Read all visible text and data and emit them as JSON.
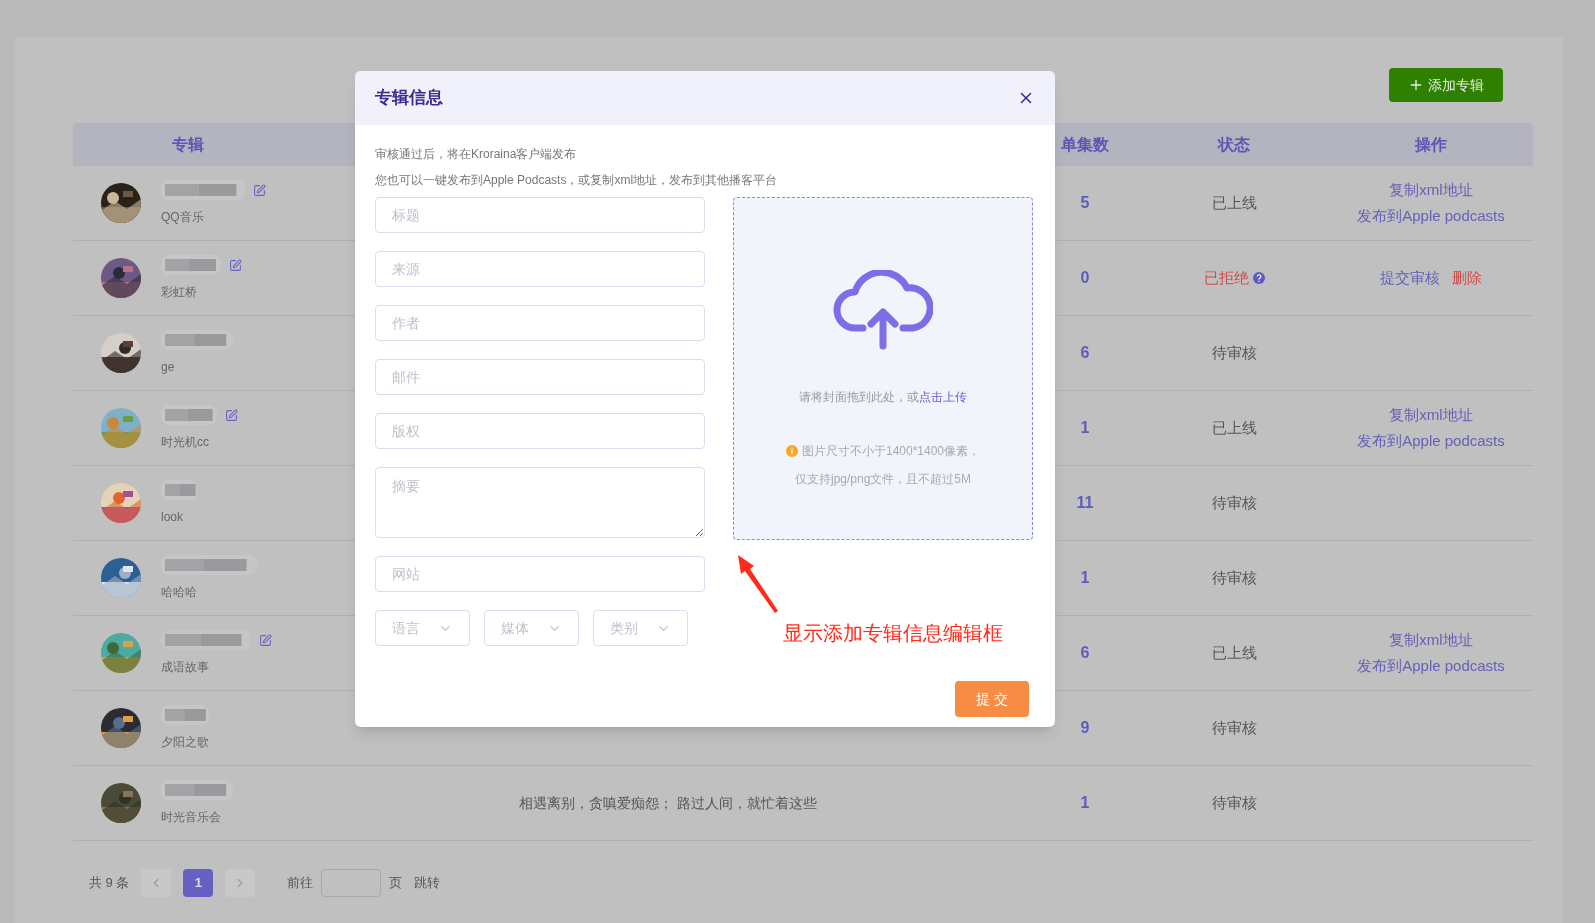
{
  "add_button": "添加专辑",
  "columns": {
    "album": "专辑",
    "episodes": "单集数",
    "status": "状态",
    "actions": "操作"
  },
  "rows": [
    {
      "source": "QQ音乐",
      "editable": true,
      "episodes": "5",
      "status": {
        "label": "已上线",
        "kind": "online"
      },
      "actions": [
        {
          "label": "复制xml地址",
          "kind": "link"
        },
        {
          "label": "发布到Apple podcasts",
          "kind": "link"
        }
      ]
    },
    {
      "source": "彩虹桥",
      "editable": true,
      "episodes": "0",
      "status": {
        "label": "已拒绝",
        "kind": "rejected"
      },
      "actions": [
        {
          "label": "提交审核",
          "kind": "link"
        },
        {
          "label": "删除",
          "kind": "danger"
        }
      ]
    },
    {
      "source": "ge",
      "editable": false,
      "episodes": "6",
      "status": {
        "label": "待审核",
        "kind": "pending"
      },
      "actions": []
    },
    {
      "source": "时光机cc",
      "editable": true,
      "episodes": "1",
      "status": {
        "label": "已上线",
        "kind": "online"
      },
      "actions": [
        {
          "label": "复制xml地址",
          "kind": "link"
        },
        {
          "label": "发布到Apple podcasts",
          "kind": "link"
        }
      ]
    },
    {
      "source": "look",
      "editable": false,
      "episodes": "11",
      "status": {
        "label": "待审核",
        "kind": "pending"
      },
      "actions": []
    },
    {
      "source": "哈哈哈",
      "editable": false,
      "episodes": "1",
      "status": {
        "label": "待审核",
        "kind": "pending"
      },
      "actions": []
    },
    {
      "source": "成语故事",
      "editable": true,
      "episodes": "6",
      "status": {
        "label": "已上线",
        "kind": "online"
      },
      "actions": [
        {
          "label": "复制xml地址",
          "kind": "link"
        },
        {
          "label": "发布到Apple podcasts",
          "kind": "link"
        }
      ]
    },
    {
      "source": "夕阳之歌",
      "editable": false,
      "episodes": "9",
      "status": {
        "label": "待审核",
        "kind": "pending"
      },
      "actions": []
    },
    {
      "source": "时光音乐会",
      "editable": false,
      "description": "相遇离别，贪嗔爱痴怨； 路过人间，就忙着这些",
      "episodes": "1",
      "status": {
        "label": "待审核",
        "kind": "pending"
      },
      "actions": []
    }
  ],
  "pagination": {
    "total": "共 9 条",
    "pages": [
      {
        "label": "1",
        "selected": true
      }
    ],
    "goto": "前往",
    "unit": "页",
    "jump": "跳转"
  },
  "dialog": {
    "title": "专辑信息",
    "notes": [
      "审核通过后，将在Kroraina客户端发布",
      "您也可以一键发布到Apple Podcasts，或复制xml地址，发布到其他播客平台"
    ],
    "fields": [
      {
        "placeholder": "标题",
        "kind": "input"
      },
      {
        "placeholder": "来源",
        "kind": "input"
      },
      {
        "placeholder": "作者",
        "kind": "input"
      },
      {
        "placeholder": "邮件",
        "kind": "input"
      },
      {
        "placeholder": "版权",
        "kind": "input"
      },
      {
        "placeholder": "摘要",
        "kind": "textarea"
      },
      {
        "placeholder": "网站",
        "kind": "input"
      }
    ],
    "selects": [
      {
        "placeholder": "语言"
      },
      {
        "placeholder": "媒体"
      },
      {
        "placeholder": "类别"
      }
    ],
    "upload": {
      "hint": "请将封面拖到此处，或",
      "link": "点击上传",
      "notes": [
        "图片尺寸不小于1400*1400像素，",
        "仅支持jpg/png文件，且不超过5M"
      ]
    },
    "submit": "提 交"
  },
  "annotation": "显示添加专辑信息编辑框"
}
